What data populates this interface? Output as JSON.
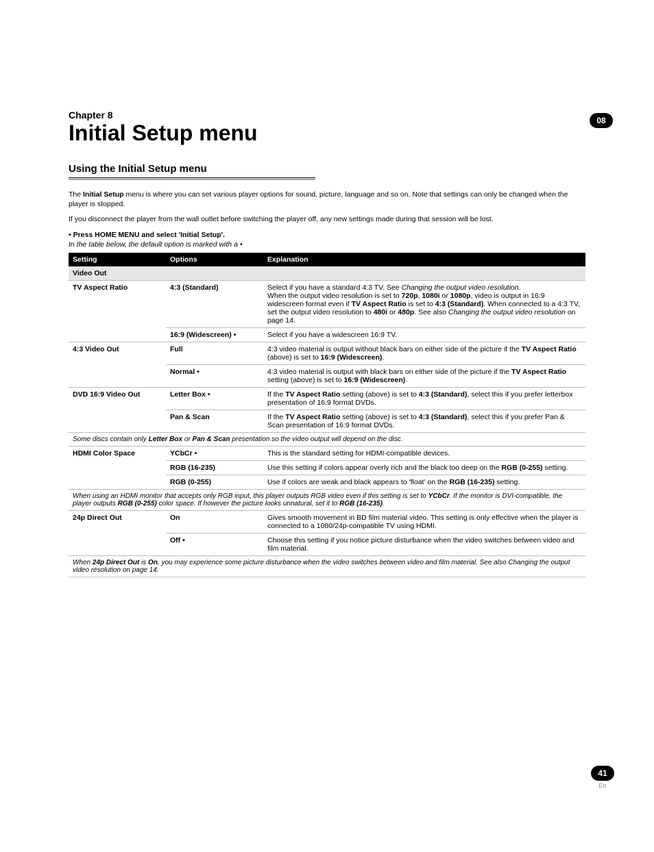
{
  "chapter": {
    "badge": "08",
    "label": "Chapter 8",
    "title": "Initial Setup menu"
  },
  "section": {
    "heading": "Using the Initial Setup menu",
    "p1_a": "The ",
    "p1_b": "Initial Setup",
    "p1_c": " menu is where you can set various player options for sound, picture, language and so on. Note that settings can only be changed when the player is stopped.",
    "p2": "If you disconnect the player from the wall outlet before switching the player off, any new settings made during that session will be lost.",
    "instr_bullet": "•   Press HOME MENU and select 'Initial Setup'.",
    "instr_note": "In the table below, the default option is marked with a •"
  },
  "table": {
    "headers": {
      "setting": "Setting",
      "options": "Options",
      "explanation": "Explanation"
    },
    "group_video_out": "Video Out",
    "rows": [
      {
        "setting": "TV Aspect Ratio",
        "option": "4:3 (Standard)",
        "explanation": "Select if you have a standard 4:3 TV. See <i>Changing the output video resolution</i>.<br>When the output video resolution is set to <b>720p</b>, <b>1080i</b> or <b>1080p</b>, video is output in 16:9 widescreen format even if <b>TV Aspect Ratio</b> is set to <b>4:3 (Standard)</b>. When connected to a 4:3 TV, set the output video resolution to <b>480i</b> or <b>480p</b>. See also <i>Changing the output video resolution</i> on page 14."
      },
      {
        "setting": "",
        "option": "16:9 (Widescreen) •",
        "explanation": "Select if you have a widescreen 16:9 TV."
      },
      {
        "setting": "4:3 Video Out",
        "option": "Full",
        "explanation": "4:3 video material is output without black bars on either side of the picture if the <b>TV Aspect Ratio</b> (above) is set to <b>16:9 (Widescreen)</b>."
      },
      {
        "setting": "",
        "option": "Normal •",
        "explanation": "4:3 video material is output with black bars on either side of the picture if the <b>TV Aspect Ratio</b> setting (above) is set to <b>16:9 (Widescreen)</b>."
      },
      {
        "setting": "DVD 16:9 Video Out",
        "option": "Letter Box •",
        "explanation": "If the <b>TV Aspect Ratio</b> setting (above) is set to <b>4:3 (Standard)</b>, select this if you prefer letterbox presentation of 16:9 format DVDs."
      },
      {
        "setting": "",
        "option": "Pan & Scan",
        "explanation": "If the <b>TV Aspect Ratio</b> setting (above) is set to <b>4:3 (Standard)</b>, select this if you prefer Pan & Scan presentation of 16:9 format DVDs."
      }
    ],
    "note1": "Some discs contain only <b>Letter Box</b> or <b>Pan & Scan</b> presentation so the video output will depend on the disc.",
    "rows2": [
      {
        "setting": "HDMI Color Space",
        "option": "YCbCr •",
        "explanation": "This is the standard setting for HDMI-compatible devices."
      },
      {
        "setting": "",
        "option": "RGB (16-235)",
        "explanation": "Use this setting if colors appear overly rich and the black too deep on the <b>RGB (0-255)</b> setting."
      },
      {
        "setting": "",
        "option": "RGB (0-255)",
        "explanation": "Use if colors are weak and black appears to 'float' on the <b>RGB (16-235)</b> setting."
      }
    ],
    "note2": "When using an HDMI monitor that accepts only RGB input, this player outputs RGB video even if this setting is set to <b>YCbCr</b>. If the monitor is DVI-compatible, the player outputs <b>RGB (0-255)</b> color space. If however the picture looks unnatural, set it to <b>RGB (16-235)</b>.",
    "rows3": [
      {
        "setting": "24p Direct Out",
        "option": "On",
        "explanation": "Gives smooth movement in BD film material video. This setting is only effective when the player is connected to a 1080/24p-compatible TV using HDMI."
      },
      {
        "setting": "",
        "option": "Off •",
        "explanation": "Choose this setting if you notice picture disturbance when the video switches between video and film material."
      }
    ],
    "note3": "When <b>24p Direct Out</b> is <b>On</b>, you may experience some picture disturbance when the video switches between video and film material. See also Changing the output video resolution on page 14."
  },
  "footer": {
    "page": "41",
    "lang": "En"
  }
}
